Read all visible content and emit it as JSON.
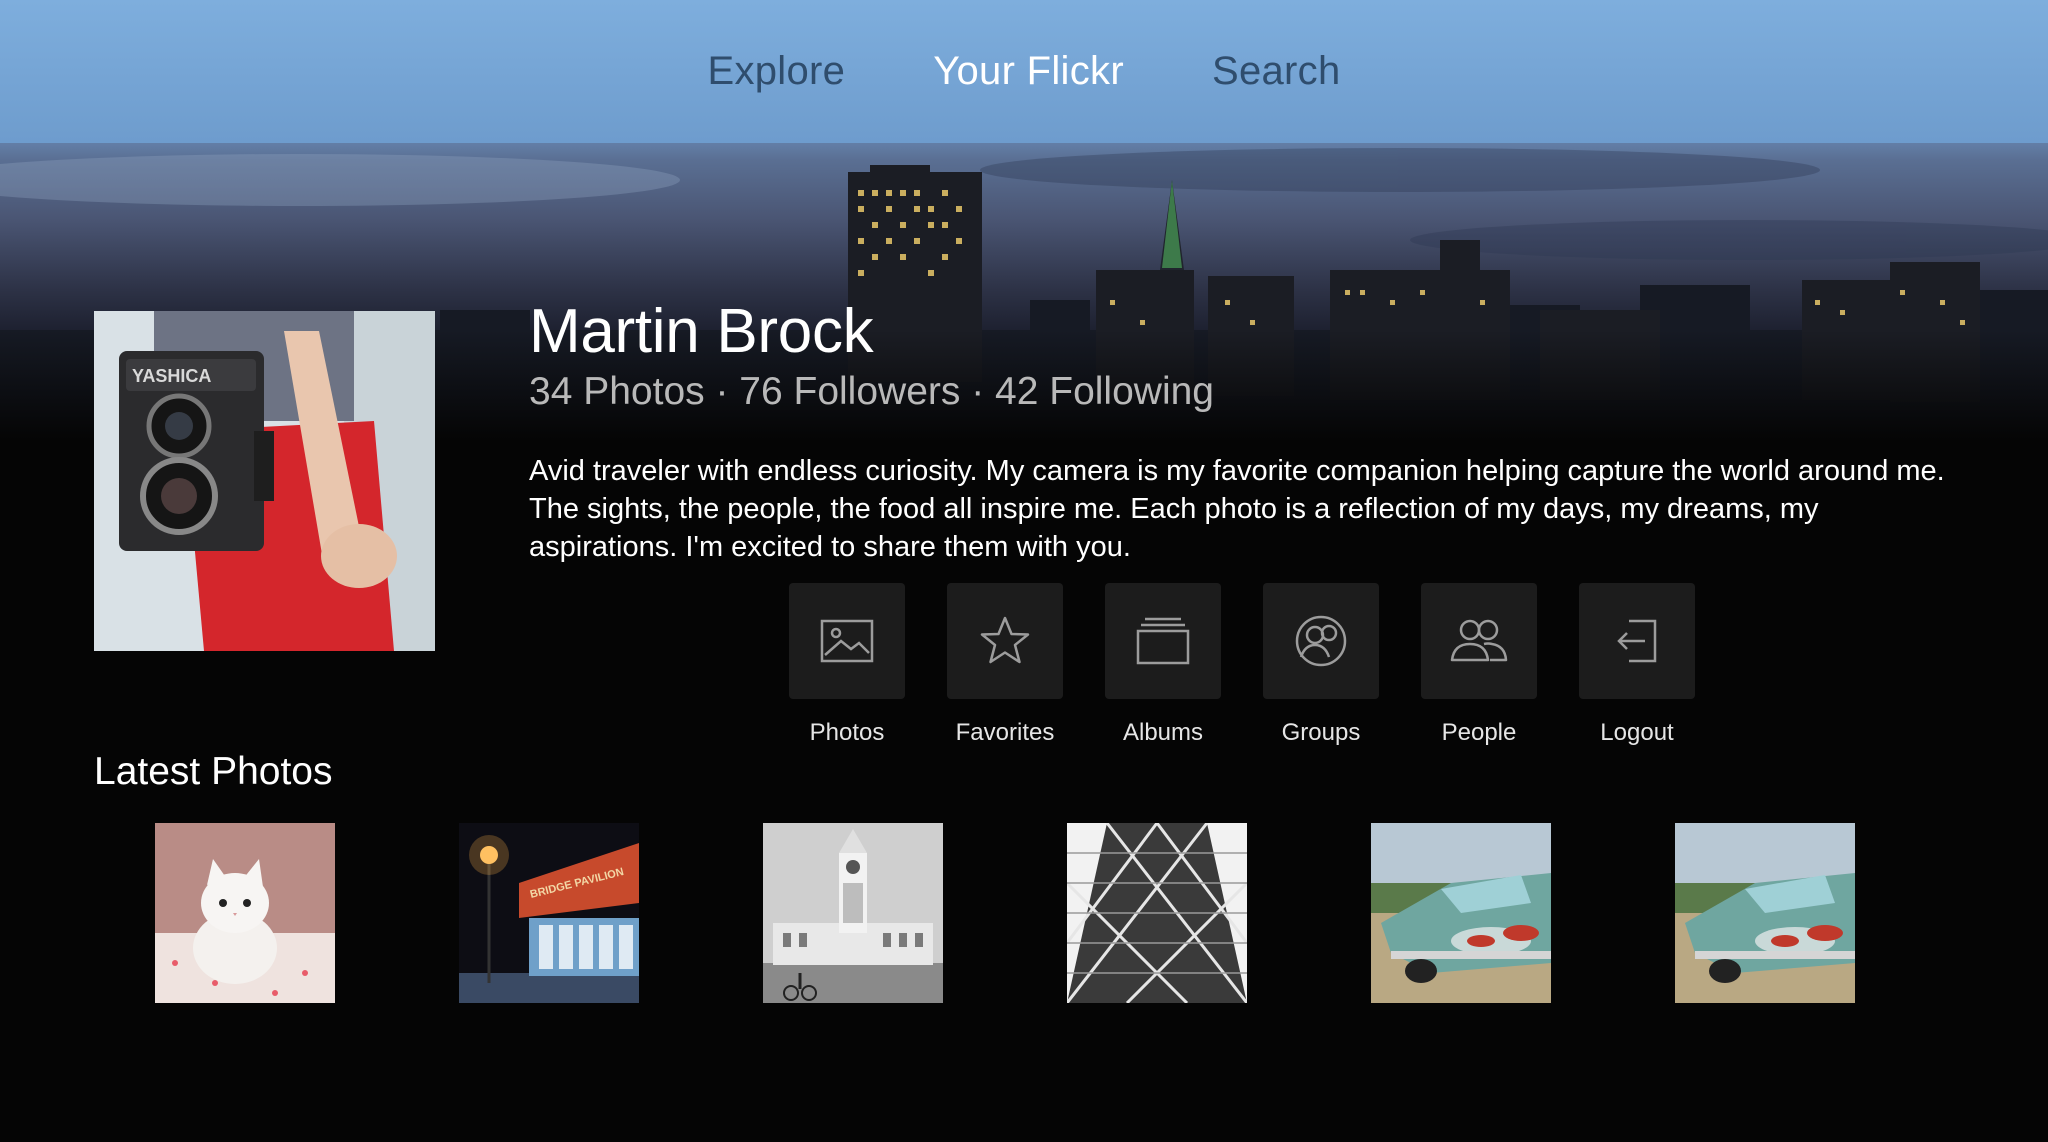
{
  "nav": {
    "tabs": [
      {
        "label": "Explore",
        "active": false
      },
      {
        "label": "Your Flickr",
        "active": true
      },
      {
        "label": "Search",
        "active": false
      }
    ]
  },
  "profile": {
    "name": "Martin Brock",
    "stats": "34 Photos · 76 Followers · 42 Following",
    "bio": "Avid traveler with endless curiosity. My camera is my favorite companion helping capture the world around me. The sights, the people, the food all inspire me. Each photo is a reflection of my days, my dreams, my aspirations. I'm excited to share them with you.",
    "avatar_camera_brand": "YASHICA"
  },
  "actions": [
    {
      "label": "Photos",
      "icon": "image-icon"
    },
    {
      "label": "Favorites",
      "icon": "star-icon"
    },
    {
      "label": "Albums",
      "icon": "albums-icon"
    },
    {
      "label": "Groups",
      "icon": "groups-icon"
    },
    {
      "label": "People",
      "icon": "people-icon"
    },
    {
      "label": "Logout",
      "icon": "logout-icon"
    }
  ],
  "latest": {
    "title": "Latest Photos",
    "photos": [
      {
        "subject": "white kitten"
      },
      {
        "subject": "bridge pavilion at night",
        "sign_text": "BRIDGE PAVILION"
      },
      {
        "subject": "clock tower building"
      },
      {
        "subject": "skyscraper facade"
      },
      {
        "subject": "vintage car"
      },
      {
        "subject": "vintage car"
      }
    ]
  },
  "colors": {
    "nav_bar": "#7eaedd",
    "nav_inactive": "#2f4d6d",
    "nav_active": "#ffffff",
    "background": "#050505",
    "tile": "#1c1c1c",
    "stats_text": "#b9b9b9"
  }
}
